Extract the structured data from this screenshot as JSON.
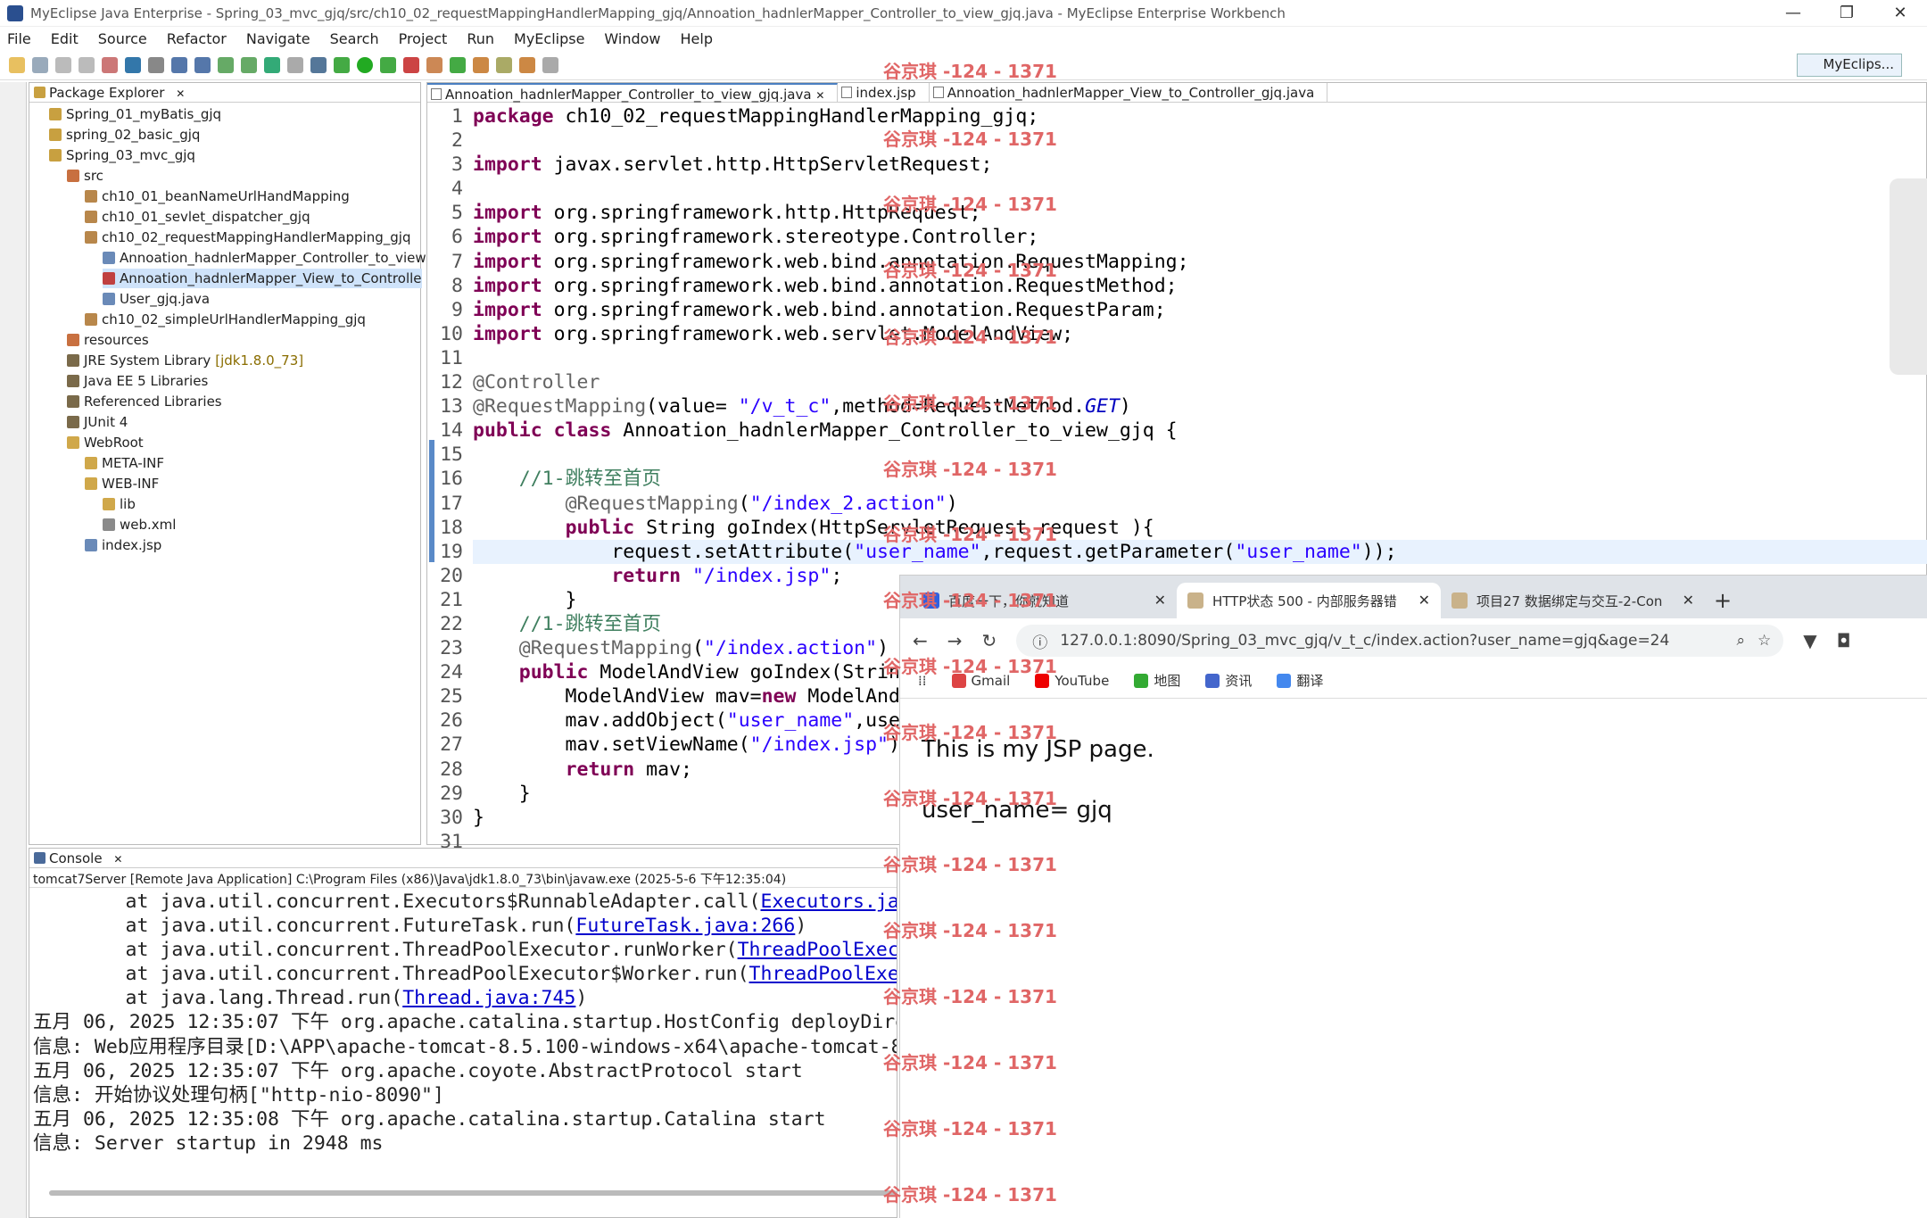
{
  "window": {
    "title": "MyEclipse Java Enterprise - Spring_03_mvc_gjq/src/ch10_02_requestMappingHandlerMapping_gjq/Annoation_hadnlerMapper_Controller_to_view_gjq.java - MyEclipse Enterprise Workbench"
  },
  "menu": [
    "File",
    "Edit",
    "Source",
    "Refactor",
    "Navigate",
    "Search",
    "Project",
    "Run",
    "MyEclipse",
    "Window",
    "Help"
  ],
  "perspective": "MyEclips...",
  "package_explorer": {
    "title": "Package Explorer",
    "items": [
      {
        "label": "Spring_01_myBatis_gjq",
        "indent": 0,
        "color": "#c8a040"
      },
      {
        "label": "spring_02_basic_gjq",
        "indent": 0,
        "color": "#c8a040"
      },
      {
        "label": "Spring_03_mvc_gjq",
        "indent": 0,
        "color": "#c8a040"
      },
      {
        "label": "src",
        "indent": 1,
        "color": "#c87040"
      },
      {
        "label": "ch10_01_beanNameUrlHandMapping",
        "indent": 2,
        "color": "#b8874b"
      },
      {
        "label": "ch10_01_sevlet_dispatcher_gjq",
        "indent": 2,
        "color": "#b8874b"
      },
      {
        "label": "ch10_02_requestMappingHandlerMapping_gjq",
        "indent": 2,
        "color": "#b8874b"
      },
      {
        "label": "Annoation_hadnlerMapper_Controller_to_view",
        "indent": 3,
        "color": "#6a8ab8"
      },
      {
        "label": "Annoation_hadnlerMapper_View_to_Controlle",
        "indent": 3,
        "color": "#c04040"
      },
      {
        "label": "User_gjq.java",
        "indent": 3,
        "color": "#6a8ab8"
      },
      {
        "label": "ch10_02_simpleUrlHandlerMapping_gjq",
        "indent": 2,
        "color": "#b8874b"
      },
      {
        "label": "resources",
        "indent": 1,
        "color": "#c87040"
      },
      {
        "label": "JRE System Library",
        "suffix": "[jdk1.8.0_73]",
        "indent": 1,
        "color": "#7a6a4a"
      },
      {
        "label": "Java EE 5 Libraries",
        "indent": 1,
        "color": "#7a6a4a"
      },
      {
        "label": "Referenced Libraries",
        "indent": 1,
        "color": "#7a6a4a"
      },
      {
        "label": "JUnit 4",
        "indent": 1,
        "color": "#7a6a4a"
      },
      {
        "label": "WebRoot",
        "indent": 1,
        "color": "#d0a84a"
      },
      {
        "label": "META-INF",
        "indent": 2,
        "color": "#d0a84a"
      },
      {
        "label": "WEB-INF",
        "indent": 2,
        "color": "#d0a84a"
      },
      {
        "label": "lib",
        "indent": 3,
        "color": "#d0a84a"
      },
      {
        "label": "web.xml",
        "indent": 3,
        "color": "#8a8a8a"
      },
      {
        "label": "index.jsp",
        "indent": 2,
        "color": "#6a8ab8"
      }
    ]
  },
  "editor": {
    "tabs": [
      "Annoation_hadnlerMapper_Controller_to_view_gjq.java",
      "index.jsp",
      "Annoation_hadnlerMapper_View_to_Controller_gjq.java"
    ],
    "line_numbers": [
      "1",
      "2",
      "3",
      "4",
      "5",
      "6",
      "7",
      "8",
      "9",
      "10",
      "11",
      "12",
      "13",
      "14",
      "15",
      "16",
      "17",
      "18",
      "19",
      "20",
      "21",
      "22",
      "23",
      "24",
      "25",
      "26",
      "27",
      "28",
      "29",
      "30",
      "31"
    ]
  },
  "console": {
    "title": "Console",
    "header": "tomcat7Server [Remote Java Application] C:\\Program Files (x86)\\Java\\jdk1.8.0_73\\bin\\javaw.exe (2025-5-6 下午12:35:04)"
  },
  "browser": {
    "tabs": [
      "百度一下，你就知道",
      "HTTP状态 500 - 内部服务器错",
      "项目27 数据绑定与交互-2-Con"
    ],
    "url": "127.0.0.1:8090/Spring_03_mvc_gjq/v_t_c/index.action?user_name=gjq&age=24",
    "bookmarks": [
      "Gmail",
      "YouTube",
      "地图",
      "资讯",
      "翻译"
    ],
    "page_line1": "This is my JSP page.",
    "page_line2": "user_name= gjq"
  },
  "watermark": "谷京琪 -124 - 1371"
}
